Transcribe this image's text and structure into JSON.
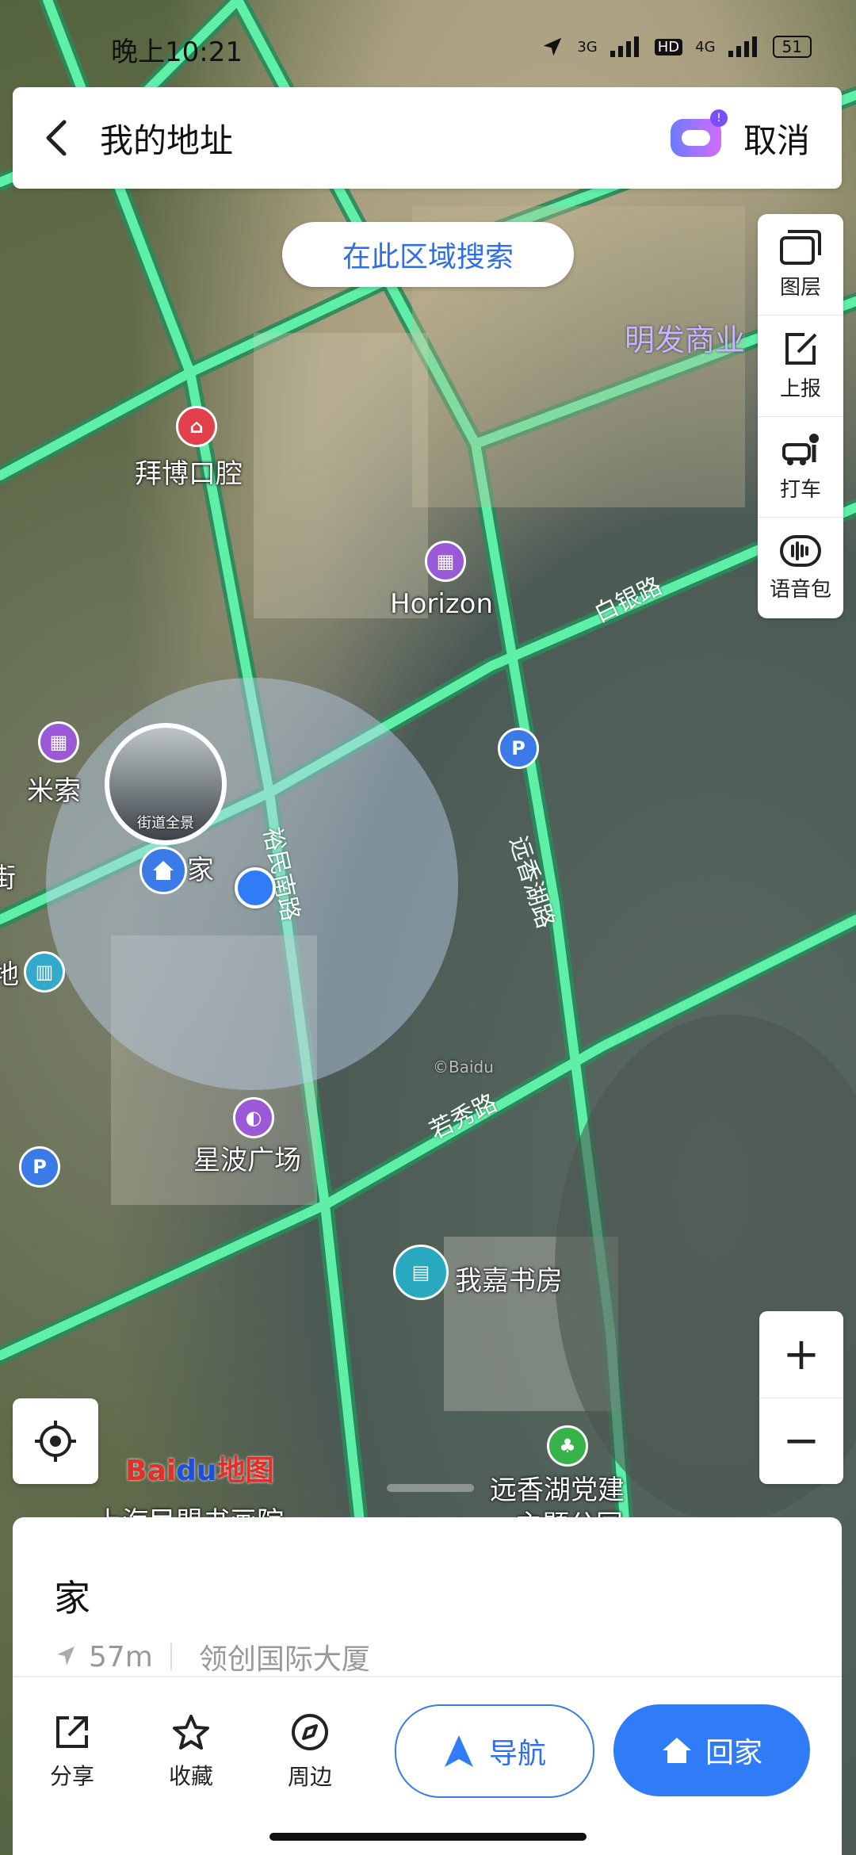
{
  "status_bar": {
    "time": "晚上10:21",
    "network_1": "3G",
    "hd": "HD",
    "network_2": "4G",
    "battery": "51"
  },
  "top_bar": {
    "title": "我的地址",
    "cancel_label": "取消"
  },
  "map": {
    "area_search_label": "在此区域搜索",
    "labels": {
      "baibo": "拜博口腔",
      "horizon": "Horizon",
      "misuo": "米索",
      "home": "家",
      "xingbo": "星波广场",
      "wojia": "我嘉书房",
      "yuanxiang_party_1": "远香湖党建",
      "yuanxiang_party_2": "主题公园",
      "shanghai_partial": "上海民盟书画院",
      "mingfa": "明发商业",
      "partial_left_1": "街",
      "partial_left_2": "地"
    },
    "roads": {
      "baiyin": "白银路",
      "yuxiang": "远香湖路",
      "ruoxiu": "若秀路",
      "yumin": "裕民南路"
    },
    "streetview_label": "街道全景",
    "watermark": "©Baidu",
    "logo_text_1": "Bai",
    "logo_text_2": "du",
    "logo_text_3": "地图"
  },
  "right_panel": [
    {
      "label": "图层",
      "icon": "layers-icon"
    },
    {
      "label": "上报",
      "icon": "report-icon"
    },
    {
      "label": "打车",
      "icon": "taxi-icon"
    },
    {
      "label": "语音包",
      "icon": "voice-pack-icon"
    }
  ],
  "zoom": {
    "in": "+",
    "out": "−"
  },
  "sheet": {
    "place_name": "家",
    "distance": "57m",
    "address": "领创国际大厦",
    "actions": [
      {
        "label": "分享",
        "icon": "share-icon"
      },
      {
        "label": "收藏",
        "icon": "star-icon"
      },
      {
        "label": "周边",
        "icon": "compass-icon"
      }
    ],
    "nav_label": "导航",
    "home_label": "回家"
  },
  "colors": {
    "accent": "#2f7cf6",
    "road": "#3fd38a"
  }
}
